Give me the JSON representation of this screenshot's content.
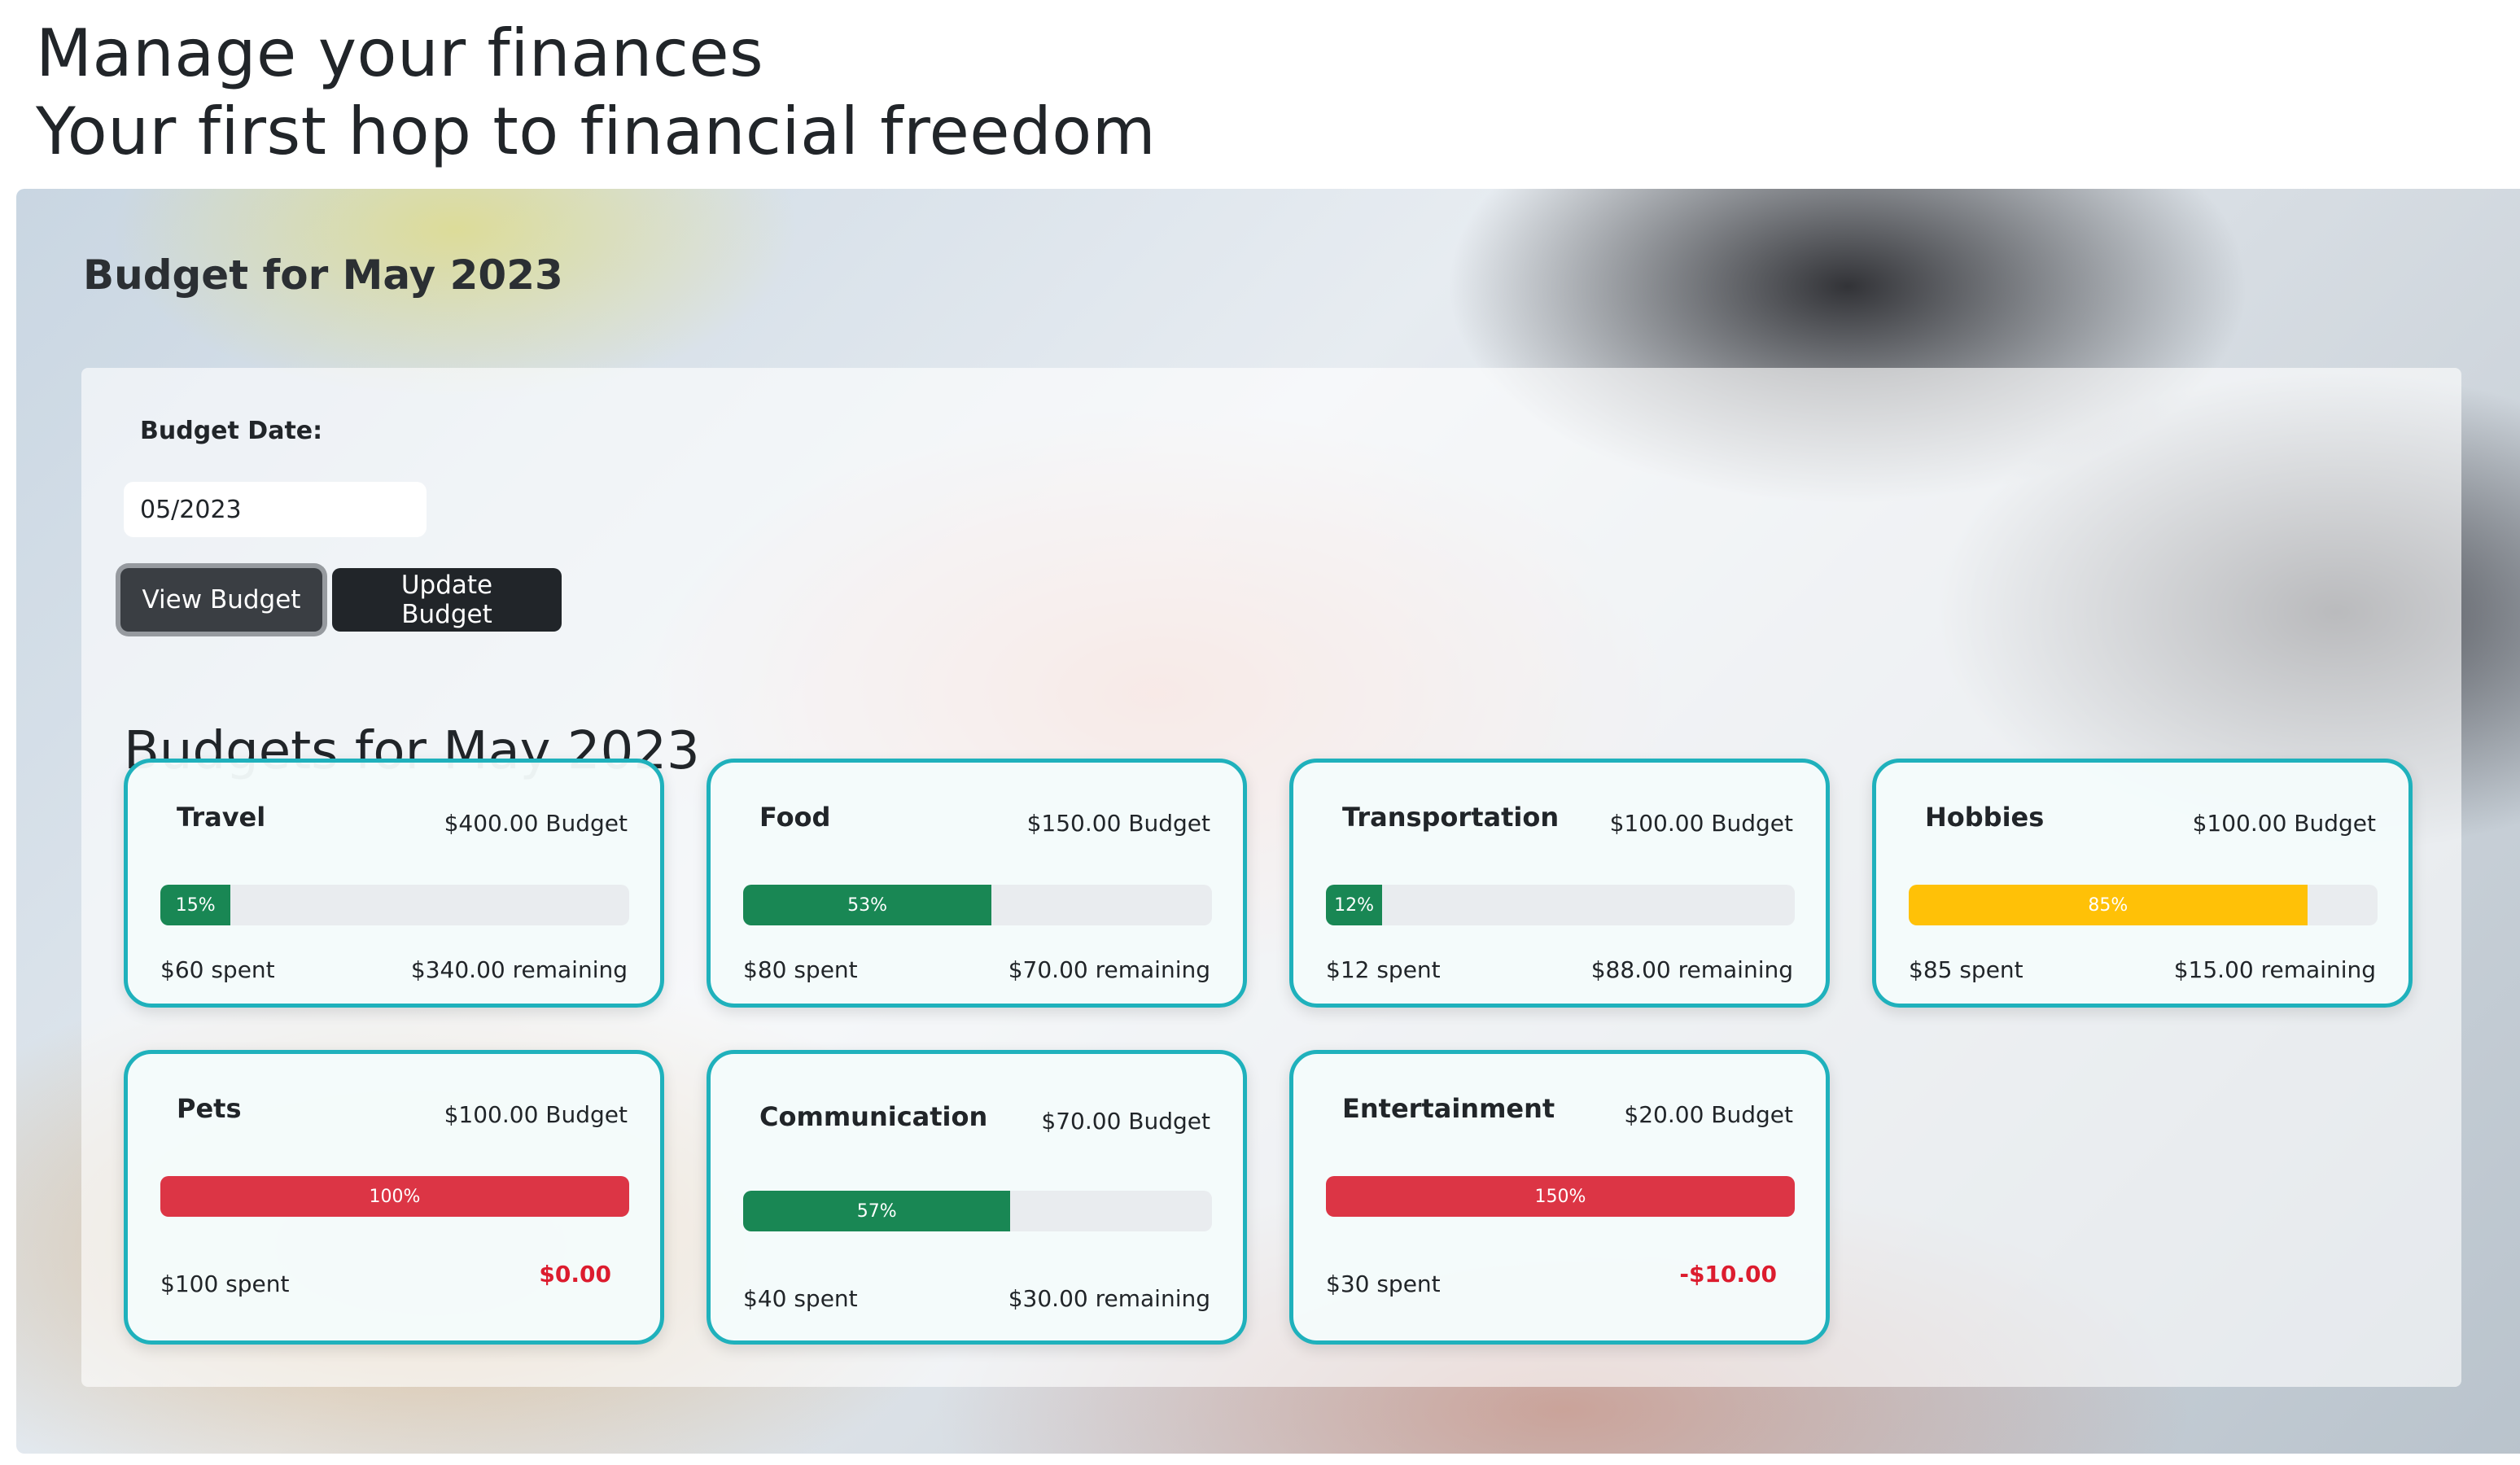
{
  "hero": {
    "line1": "Manage your finances",
    "line2": "Your first hop to financial freedom"
  },
  "panel": {
    "heading": "Budget for May 2023",
    "date_label": "Budget Date:",
    "date_value": "05/2023",
    "view_button": "View Budget",
    "update_button": "Update Budget",
    "budgets_heading": "Budgets for May 2023"
  },
  "colors": {
    "success": "#198754",
    "warning": "#ffc107",
    "danger": "#dc3545",
    "card_border": "#1fb1bc"
  },
  "budgets": [
    {
      "name": "Travel",
      "budget": "$400.00 Budget",
      "percent": 15,
      "percent_label": "15%",
      "status": "success",
      "spent": "$60 spent",
      "remaining": "$340.00 remaining",
      "over": false
    },
    {
      "name": "Food",
      "budget": "$150.00 Budget",
      "percent": 53,
      "percent_label": "53%",
      "status": "success",
      "spent": "$80 spent",
      "remaining": "$70.00 remaining",
      "over": false
    },
    {
      "name": "Transportation",
      "budget": "$100.00 Budget",
      "percent": 12,
      "percent_label": "12%",
      "status": "success",
      "spent": "$12 spent",
      "remaining": "$88.00 remaining",
      "over": false
    },
    {
      "name": "Hobbies",
      "budget": "$100.00 Budget",
      "percent": 85,
      "percent_label": "85%",
      "status": "warning",
      "spent": "$85 spent",
      "remaining": "$15.00 remaining",
      "over": false
    },
    {
      "name": "Pets",
      "budget": "$100.00 Budget",
      "percent": 100,
      "percent_label": "100%",
      "status": "danger",
      "spent": "$100 spent",
      "remaining": "$0.00",
      "over": true
    },
    {
      "name": "Communication",
      "budget": "$70.00 Budget",
      "percent": 57,
      "percent_label": "57%",
      "status": "success",
      "spent": "$40 spent",
      "remaining": "$30.00 remaining",
      "over": false
    },
    {
      "name": "Entertainment",
      "budget": "$20.00 Budget",
      "percent": 150,
      "percent_label": "150%",
      "status": "danger",
      "spent": "$30 spent",
      "remaining": "-$10.00",
      "over": true
    }
  ]
}
